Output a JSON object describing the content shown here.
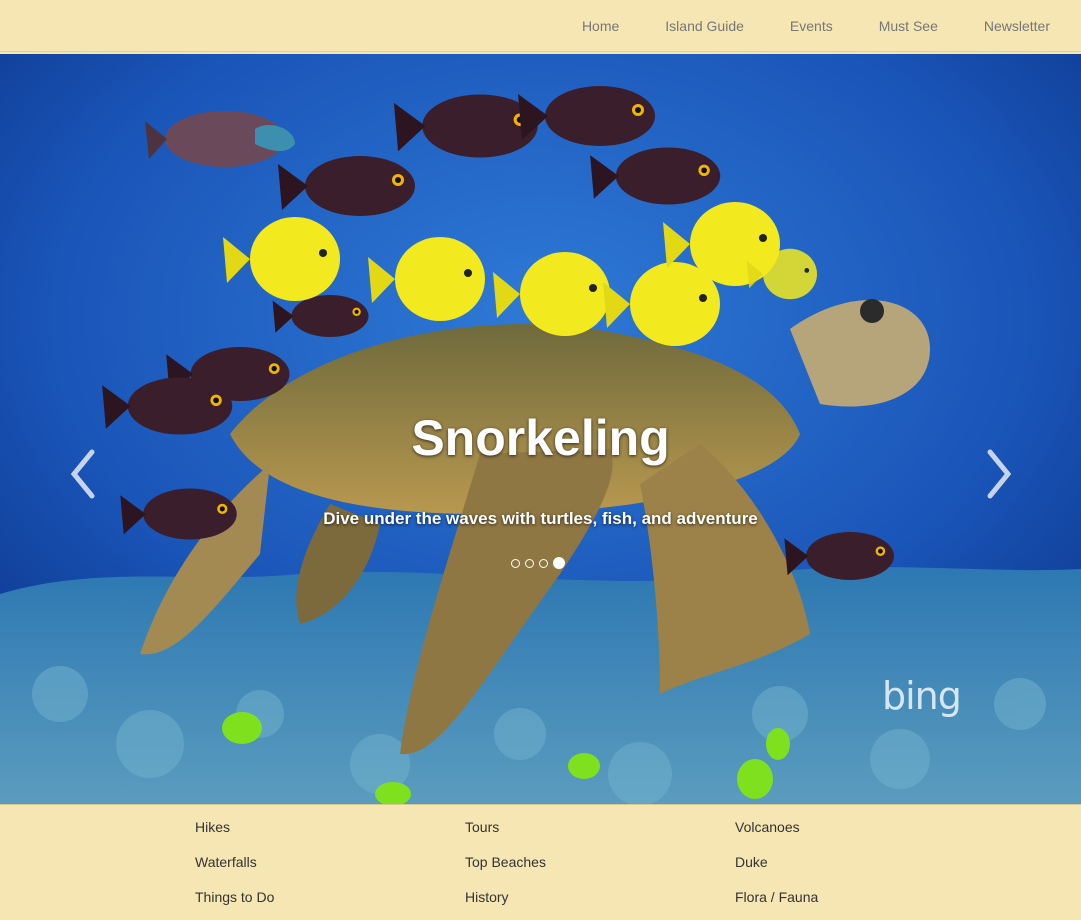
{
  "nav": {
    "items": [
      {
        "label": "Home"
      },
      {
        "label": "Island Guide"
      },
      {
        "label": "Events"
      },
      {
        "label": "Must See"
      },
      {
        "label": "Newsletter"
      }
    ]
  },
  "carousel": {
    "title": "Snorkeling",
    "subtitle": "Dive under the waves with turtles, fish, and adventure",
    "indicator_count": 4,
    "active_index": 3,
    "watermark": "bing"
  },
  "footer": {
    "columns": [
      {
        "links": [
          "Hikes",
          "Waterfalls",
          "Things to Do"
        ]
      },
      {
        "links": [
          "Tours",
          "Top Beaches",
          "History"
        ]
      },
      {
        "links": [
          "Volcanoes",
          "Duke",
          "Flora / Fauna"
        ]
      }
    ]
  },
  "colors": {
    "nav_background": "#f5e6b3",
    "water_deep": "#0a3d9a",
    "water_light": "#2a6fd0",
    "reef": "#3f86b0",
    "yellow_tang": "#f1e81f",
    "dark_fish": "#3a1f2a"
  }
}
